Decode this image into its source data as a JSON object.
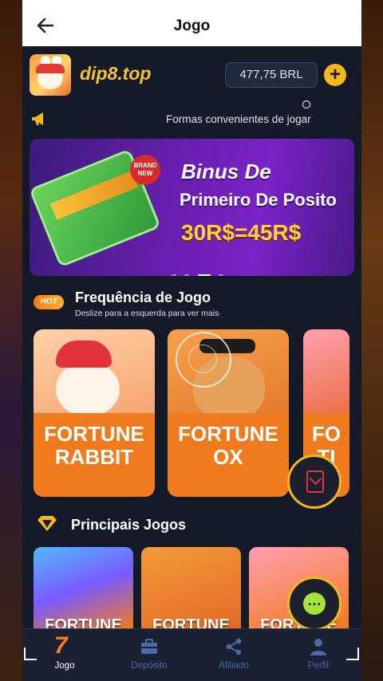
{
  "header": {
    "title": "Jogo"
  },
  "topbar": {
    "brand": "dip8.top",
    "balance": "477,75 BRL",
    "add_label": "+"
  },
  "notice": {
    "text": "Formas convenientes de jogar"
  },
  "banner": {
    "line1": "Binus De",
    "line2": "Primeiro De Posito",
    "line3": "30R$=45R$",
    "badge": "BRAND NEW",
    "slides": 4,
    "active_slide": 3
  },
  "frequency": {
    "badge": "HOT",
    "title": "Frequência de Jogo",
    "subtitle": "Deslize para a esquerda para ver mais",
    "games": [
      {
        "name": "FORTUNE RABBIT"
      },
      {
        "name": "FORTUNE OX"
      },
      {
        "name": "FO TI"
      }
    ]
  },
  "principal": {
    "title": "Principais Jogos",
    "games": [
      {
        "name": "FORTUNE"
      },
      {
        "name": "FORTUNE"
      },
      {
        "name": "FORTUNE"
      }
    ]
  },
  "nav": {
    "items": [
      {
        "label": "Jogo",
        "icon": "seven-icon"
      },
      {
        "label": "Depósito",
        "icon": "briefcase-icon"
      },
      {
        "label": "Afiliado",
        "icon": "share-icon"
      },
      {
        "label": "Perfil",
        "icon": "user-icon"
      }
    ],
    "active": 0
  },
  "colors": {
    "accent": "#f5b81c",
    "brand": "#f4c234",
    "card": "#f07a1e",
    "nav_inactive": "#4a6aa8"
  }
}
